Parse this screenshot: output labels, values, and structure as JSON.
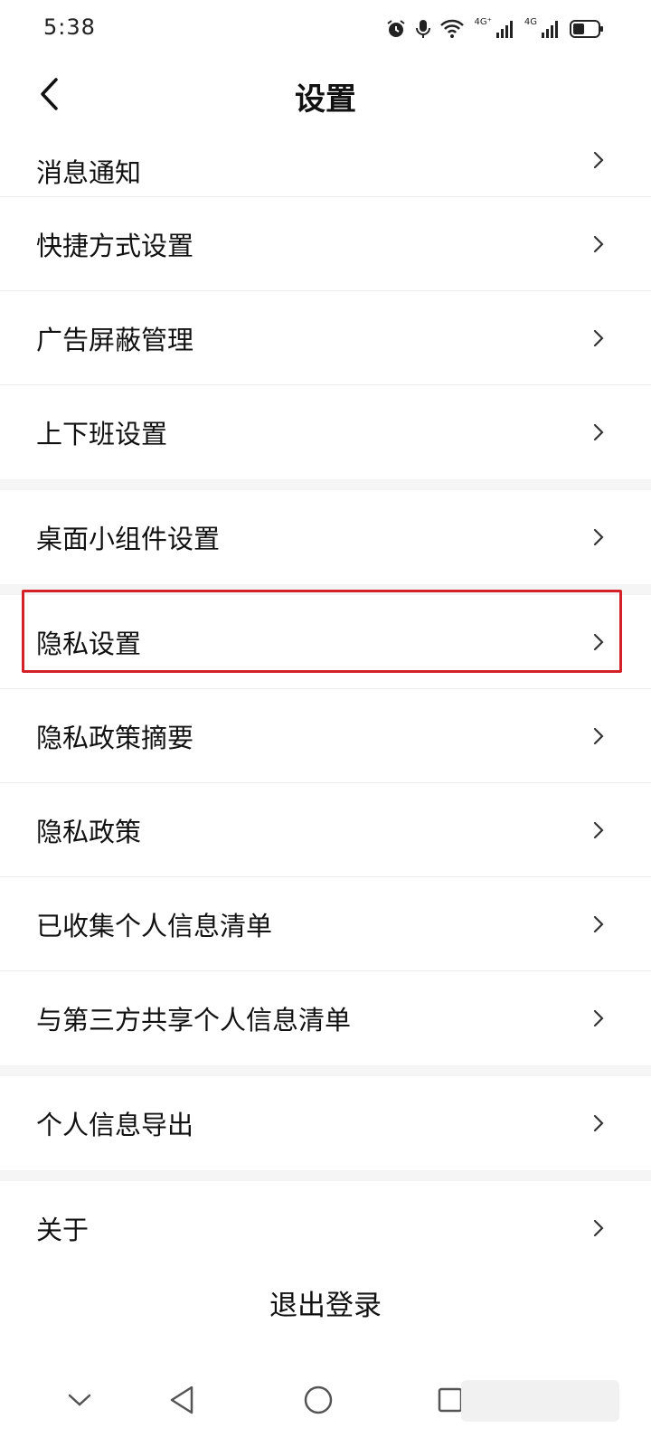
{
  "status_bar": {
    "time": "5:38",
    "network_1": "4G⁺",
    "network_2": "4G",
    "icons": [
      "alarm-icon",
      "mic-icon",
      "wifi-icon",
      "signal-icon",
      "signal-icon",
      "battery-icon"
    ]
  },
  "header": {
    "title": "设置",
    "back_icon": "back-chevron-icon"
  },
  "settings_list": [
    {
      "label": "消息通知"
    },
    {
      "label": "快捷方式设置"
    },
    {
      "label": "广告屏蔽管理"
    },
    {
      "label": "上下班设置"
    },
    {
      "label": "桌面小组件设置"
    },
    {
      "label": "隐私设置",
      "highlighted": true
    },
    {
      "label": "隐私政策摘要"
    },
    {
      "label": "隐私政策"
    },
    {
      "label": "已收集个人信息清单"
    },
    {
      "label": "与第三方共享个人信息清单"
    },
    {
      "label": "个人信息导出"
    },
    {
      "label": "关于"
    }
  ],
  "logout": {
    "label": "退出登录"
  },
  "bottom_nav": {
    "items": [
      "collapse-icon",
      "back-triangle-icon",
      "home-circle-icon",
      "recents-square-icon"
    ]
  },
  "colors": {
    "highlight_border": "#d32029",
    "section_gap": "#f5f5f5",
    "divider": "#ececec"
  }
}
